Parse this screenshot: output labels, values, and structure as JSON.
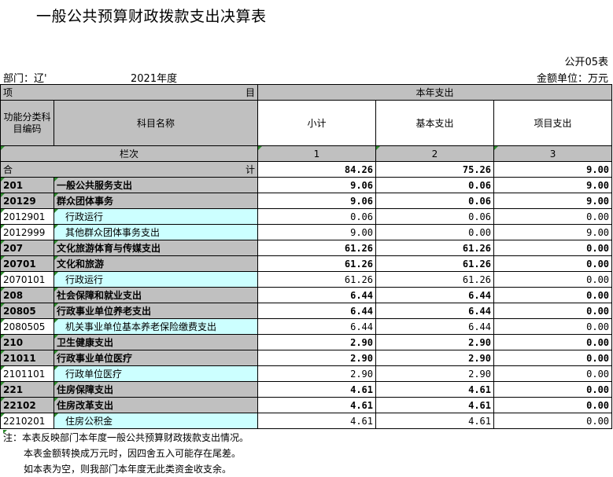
{
  "title": "一般公共预算财政拨款支出决算表",
  "form_code": "公开05表",
  "dept_label": "部门：辽'",
  "year_label": "2021年度",
  "unit_label": "金额单位：万元",
  "header": {
    "item_left": "项",
    "item_right": "目",
    "current_year": "本年支出",
    "func_code": "功能分类科目编码",
    "subject_name": "科目名称",
    "subtotal": "小计",
    "basic": "基本支出",
    "project": "项目支出",
    "row_order": "栏次",
    "col1": "1",
    "col2": "2",
    "col3": "3"
  },
  "total": {
    "left": "合",
    "right": "计",
    "subtotal": "84.26",
    "basic": "75.26",
    "project": "9.00"
  },
  "rows": [
    {
      "code": "201",
      "name": "一般公共服务支出",
      "subtotal": "9.06",
      "basic": "0.06",
      "project": "9.00",
      "level": 1
    },
    {
      "code": "20129",
      "name": "群众团体事务",
      "subtotal": "9.06",
      "basic": "0.06",
      "project": "9.00",
      "level": 2
    },
    {
      "code": "2012901",
      "name": "行政运行",
      "subtotal": "0.06",
      "basic": "0.06",
      "project": "0.00",
      "level": 3
    },
    {
      "code": "2012999",
      "name": "其他群众团体事务支出",
      "subtotal": "9.00",
      "basic": "0.00",
      "project": "9.00",
      "level": 3
    },
    {
      "code": "207",
      "name": "文化旅游体育与传媒支出",
      "subtotal": "61.26",
      "basic": "61.26",
      "project": "0.00",
      "level": 1
    },
    {
      "code": "20701",
      "name": "文化和旅游",
      "subtotal": "61.26",
      "basic": "61.26",
      "project": "0.00",
      "level": 2
    },
    {
      "code": "2070101",
      "name": "行政运行",
      "subtotal": "61.26",
      "basic": "61.26",
      "project": "0.00",
      "level": 3
    },
    {
      "code": "208",
      "name": "社会保障和就业支出",
      "subtotal": "6.44",
      "basic": "6.44",
      "project": "0.00",
      "level": 1
    },
    {
      "code": "20805",
      "name": "行政事业单位养老支出",
      "subtotal": "6.44",
      "basic": "6.44",
      "project": "0.00",
      "level": 2
    },
    {
      "code": "2080505",
      "name": "机关事业单位基本养老保险缴费支出",
      "subtotal": "6.44",
      "basic": "6.44",
      "project": "0.00",
      "level": 3
    },
    {
      "code": "210",
      "name": "卫生健康支出",
      "subtotal": "2.90",
      "basic": "2.90",
      "project": "0.00",
      "level": 1
    },
    {
      "code": "21011",
      "name": "行政事业单位医疗",
      "subtotal": "2.90",
      "basic": "2.90",
      "project": "0.00",
      "level": 2
    },
    {
      "code": "2101101",
      "name": "行政单位医疗",
      "subtotal": "2.90",
      "basic": "2.90",
      "project": "0.00",
      "level": 3
    },
    {
      "code": "221",
      "name": "住房保障支出",
      "subtotal": "4.61",
      "basic": "4.61",
      "project": "0.00",
      "level": 1
    },
    {
      "code": "22102",
      "name": "住房改革支出",
      "subtotal": "4.61",
      "basic": "4.61",
      "project": "0.00",
      "level": 2
    },
    {
      "code": "2210201",
      "name": "住房公积金",
      "subtotal": "4.61",
      "basic": "4.61",
      "project": "0.00",
      "level": 3
    }
  ],
  "notes": [
    "注：本表反映部门本年度一般公共预算财政拨款支出情况。",
    "本表金额转换成万元时，因四舍五入可能存在尾差。",
    "如本表为空，则我部门本年度无此类资金收支余。"
  ]
}
